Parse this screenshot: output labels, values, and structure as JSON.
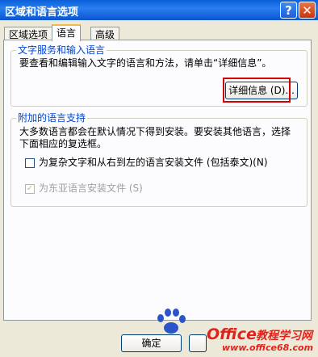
{
  "window": {
    "title": "区域和语言选项",
    "help_label": "?",
    "close_label": "✕"
  },
  "tabs": [
    {
      "label": "区域选项"
    },
    {
      "label": "语言"
    },
    {
      "label": "高级"
    }
  ],
  "text_services": {
    "legend": "文字服务和输入语言",
    "description": "要查看和编辑输入文字的语言和方法，请单击“详细信息”。",
    "details_button": "详细信息 (D)..."
  },
  "supplemental": {
    "legend": "附加的语言支持",
    "line1": "大多数语言都会在默认情况下得到安装。要安装其他语言，选择",
    "line2": "下面相应的复选框。",
    "complex_script": {
      "label": "为复杂文字和从右到左的语言安装文件 (包括泰文)(N)",
      "checked": false
    },
    "east_asian": {
      "label": "为东亚语言安装文件 (S)",
      "checked": true,
      "enabled": false
    }
  },
  "footer": {
    "ok_label": "确定"
  },
  "watermark": {
    "office": "Office",
    "brand": "教程学习网",
    "url": "www.office68.com"
  },
  "colors": {
    "titlebar": "#0a5fd8",
    "legend": "#0046d5",
    "highlight_box": "#d30000",
    "watermark": "#e0221a"
  }
}
